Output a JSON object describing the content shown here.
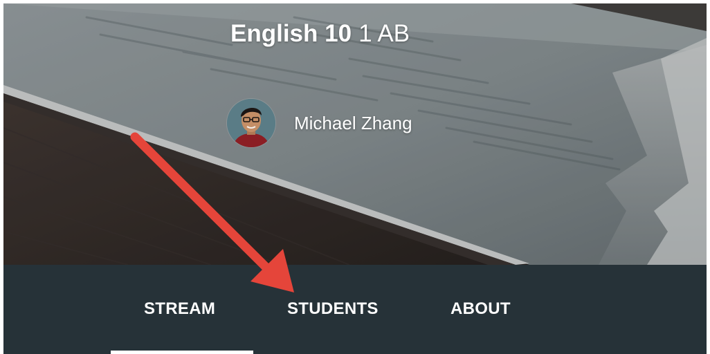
{
  "course": {
    "title": "English 10",
    "section": "1 AB"
  },
  "teacher": {
    "name": "Michael Zhang"
  },
  "tabs": [
    {
      "label": "STREAM",
      "active": true
    },
    {
      "label": "STUDENTS",
      "active": false
    },
    {
      "label": "ABOUT",
      "active": false
    }
  ],
  "colors": {
    "tab_bar": "#263238",
    "annotation_arrow": "#e5453a",
    "active_indicator": "#ffffff"
  },
  "icons": {
    "avatar": "teacher-avatar-photo",
    "annotation": "red-arrow"
  }
}
